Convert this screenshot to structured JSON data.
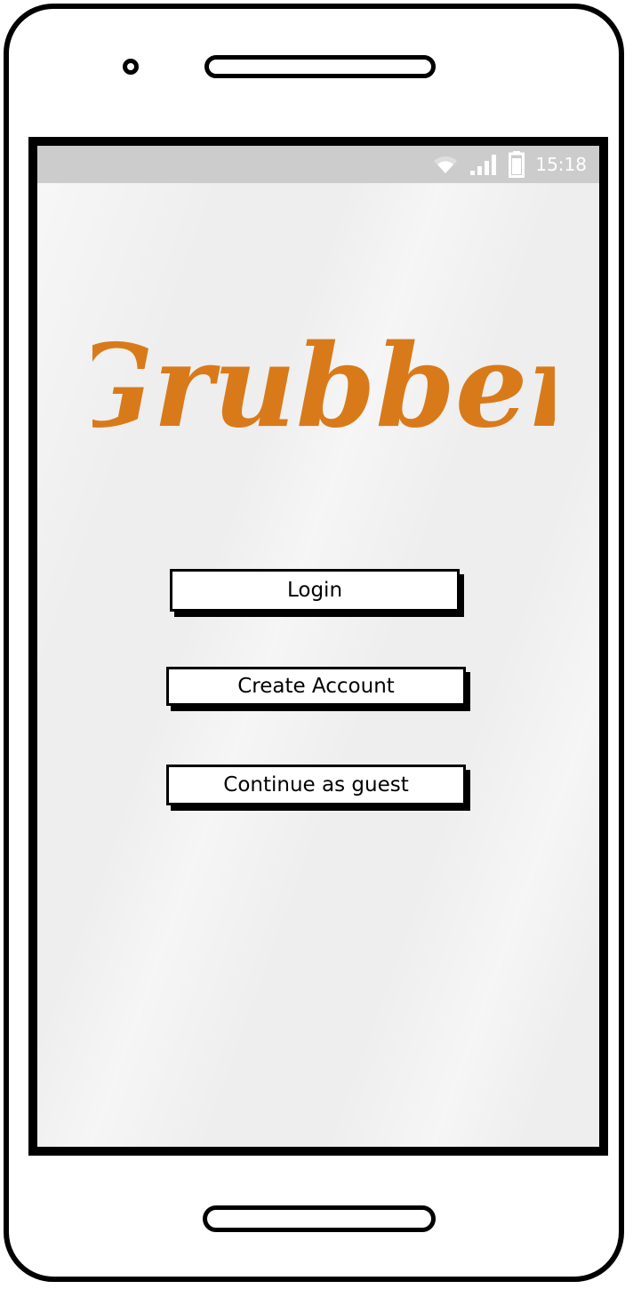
{
  "status_bar": {
    "time": "15:18",
    "icons": [
      "wifi-icon",
      "cellular-signal-icon",
      "battery-icon"
    ]
  },
  "app": {
    "logo_text": "Grubber",
    "brand_color": "#d97a1a"
  },
  "buttons": {
    "login": "Login",
    "create_account": "Create Account",
    "continue_guest": "Continue as guest"
  },
  "colors": {
    "status_bar_bg": "#cccccc",
    "screen_bg": "#eeeeee",
    "button_bg": "#ffffff",
    "outline": "#000000"
  }
}
